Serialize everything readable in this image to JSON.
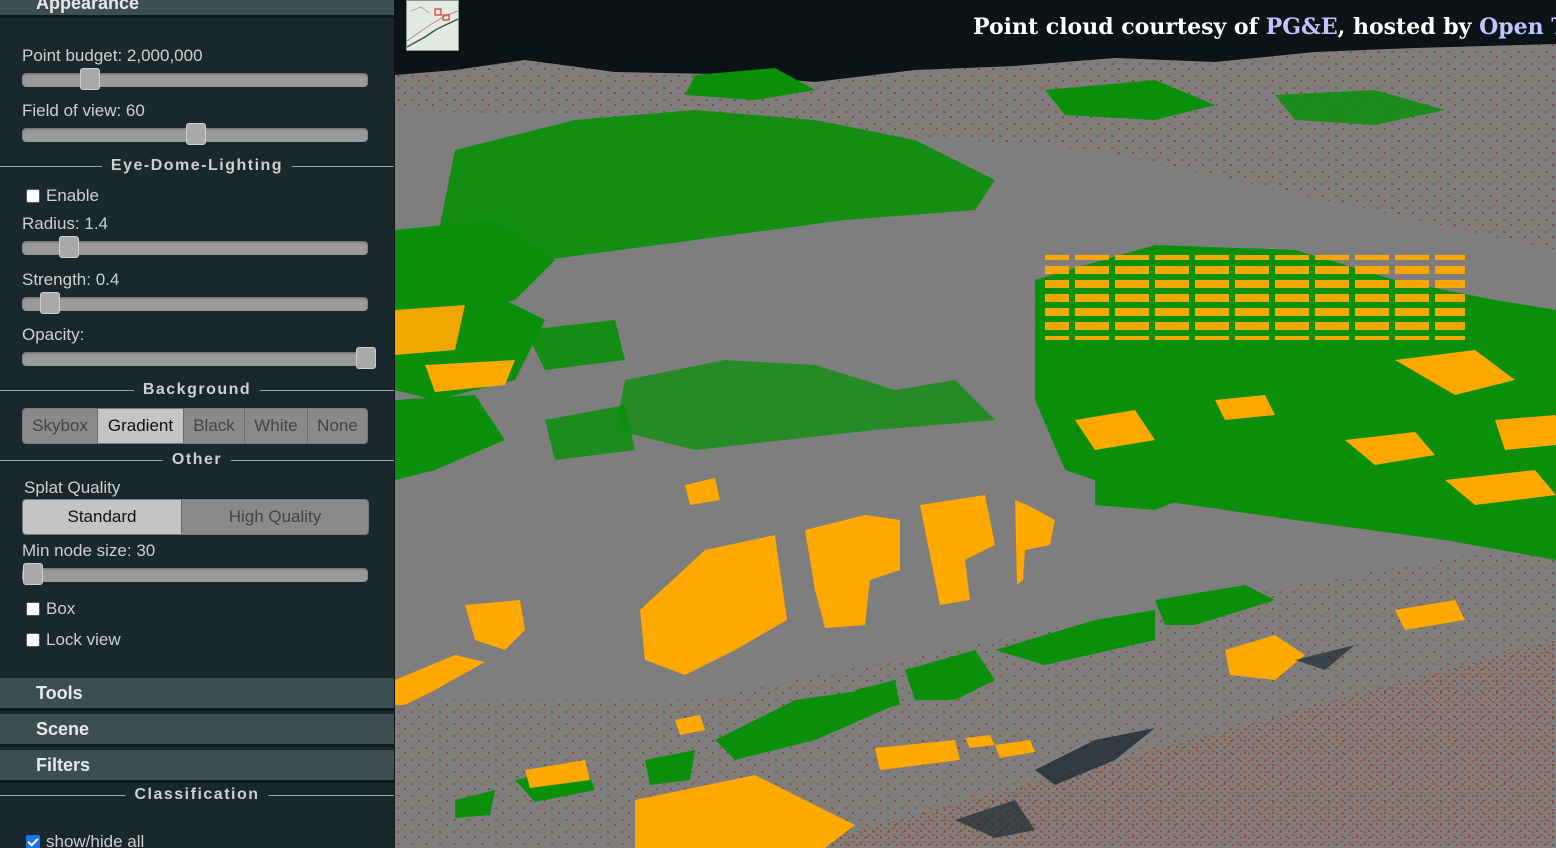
{
  "sidebar": {
    "appearance_header": "Appearance",
    "point_budget": {
      "label": "Point budget: 2,000,000",
      "value": 2000000
    },
    "field_of_view": {
      "label": "Field of view: 60",
      "value": 60
    },
    "edl": {
      "section_title": "Eye-Dome-Lighting",
      "enable_label": "Enable",
      "enable_checked": false,
      "radius_label": "Radius: 1.4",
      "strength_label": "Strength: 0.4",
      "opacity_label": "Opacity:"
    },
    "background": {
      "section_title": "Background",
      "options": [
        "Skybox",
        "Gradient",
        "Black",
        "White",
        "None"
      ],
      "selected": "Gradient"
    },
    "other": {
      "section_title": "Other",
      "splat_quality_label": "Splat Quality",
      "splat_options": [
        "Standard",
        "High Quality"
      ],
      "splat_selected": "Standard",
      "min_node_size_label": "Min node size: 30",
      "box_label": "Box",
      "box_checked": false,
      "lock_view_label": "Lock view",
      "lock_view_checked": false
    },
    "tools_header": "Tools",
    "scene_header": "Scene",
    "filters_header": "Filters",
    "classification": {
      "section_title": "Classification",
      "show_hide_all_label": "show/hide all",
      "show_hide_all_checked": true
    }
  },
  "viewer": {
    "attribution_prefix": "Point cloud courtesy of ",
    "attribution_link1": "PG&E",
    "attribution_mid": ", hosted by ",
    "attribution_link2": "Open To",
    "colors": {
      "ground": "#7e7e7e",
      "vegetation": "#0a8f0a",
      "building": "#ffa800",
      "soil": "#9b5535",
      "sky": "#0b1316"
    }
  }
}
